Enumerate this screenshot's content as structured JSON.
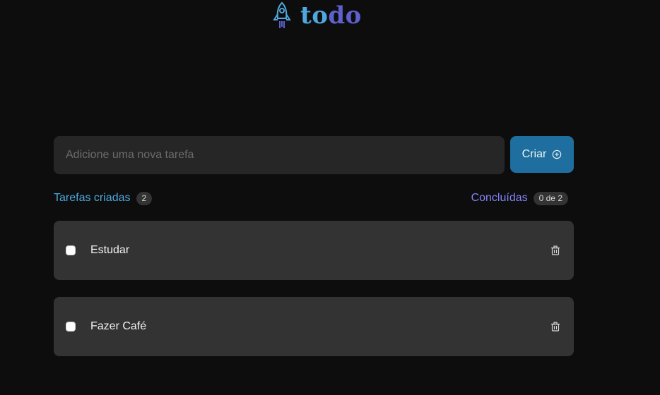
{
  "header": {
    "logo_icon": "rocket-icon",
    "logo_part1": "to",
    "logo_part2": "do",
    "colors": {
      "to": "#4ea8de",
      "do": "#5e60ce"
    }
  },
  "new_task": {
    "placeholder": "Adicione uma nova tarefa",
    "value": "",
    "create_label": "Criar",
    "create_icon": "plus-circle-icon"
  },
  "stats": {
    "created_label": "Tarefas criadas",
    "created_count": "2",
    "done_label": "Concluídas",
    "done_count": "0 de 2"
  },
  "tasks": [
    {
      "title": "Estudar",
      "done": false,
      "delete_icon": "trash-icon"
    },
    {
      "title": "Fazer Café",
      "done": false,
      "delete_icon": "trash-icon"
    }
  ],
  "colors": {
    "background": "#0d0d0d",
    "card": "#333333",
    "input": "#262626",
    "button": "#1e6f9f",
    "blue": "#4ea8de",
    "purple": "#8284fa"
  }
}
